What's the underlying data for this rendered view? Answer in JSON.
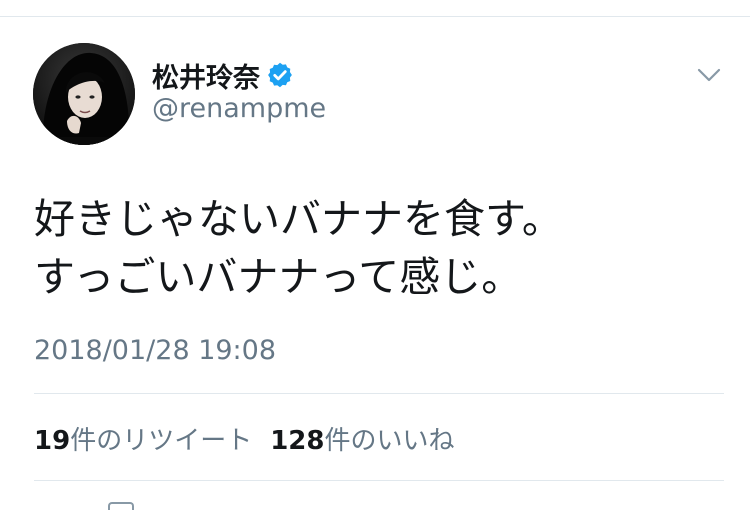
{
  "tweet": {
    "author": {
      "display_name": "松井玲奈",
      "handle": "@renampme",
      "verified": true,
      "avatar_icon": "user-avatar-photo"
    },
    "text_lines": [
      "好きじゃないバナナを食す。",
      "すっごいバナナって感じ。"
    ],
    "timestamp": "2018/01/28 19:08",
    "retweets": {
      "count": "19",
      "label": "件のリツイート"
    },
    "likes": {
      "count": "128",
      "label": "件のいいね"
    }
  },
  "icons": {
    "verified": "verified-badge-icon",
    "menu": "chevron-down-icon"
  },
  "colors": {
    "verified_blue": "#1da1f2",
    "secondary_text": "#657786",
    "divider": "#e1e8ed",
    "primary_text": "#14171a"
  }
}
